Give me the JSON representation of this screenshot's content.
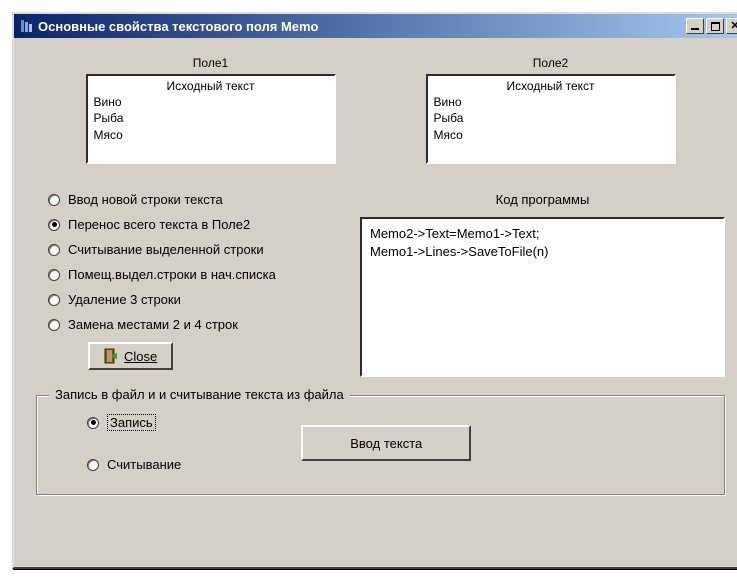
{
  "window": {
    "title": "Основные свойства текстового поля Memo"
  },
  "field1": {
    "label": "Поле1",
    "header": "Исходный текст",
    "lines": [
      "Вино",
      "Рыба",
      "Мясо"
    ]
  },
  "field2": {
    "label": "Поле2",
    "header": "Исходный текст",
    "lines": [
      "Вино",
      "Рыба",
      "Мясо"
    ]
  },
  "actions": {
    "items": [
      "Ввод новой строки текста",
      "Перенос всего текста в Поле2",
      "Считывание выделенной строки",
      "Помещ.выдел.строки в нач.списка",
      "Удаление 3 строки",
      "Замена местами 2 и 4 строк"
    ],
    "selected_index": 1
  },
  "code": {
    "label": "Код программы",
    "lines": [
      "Memo2->Text=Memo1->Text;",
      " Memo1->Lines->SaveToFile(n)"
    ]
  },
  "close_button": "Close",
  "file_group": {
    "title": "Запись в файл и  и считывание текста из файла",
    "options": [
      "Запись",
      "Считывание"
    ],
    "selected_index": 0,
    "button": "Ввод текста"
  }
}
